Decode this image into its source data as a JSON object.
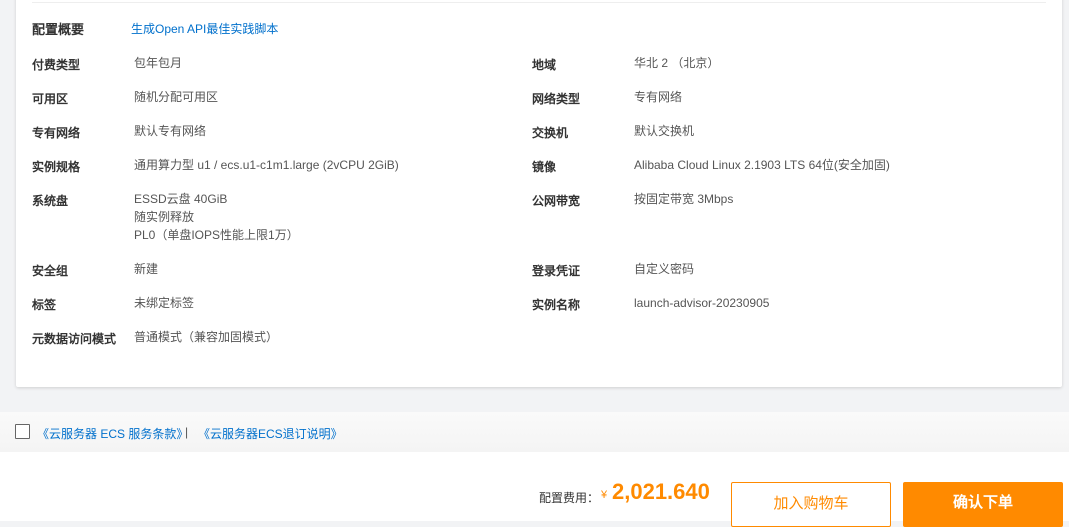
{
  "summary": {
    "title": "配置概要",
    "api_link": "生成Open API最佳实践脚本"
  },
  "left": [
    {
      "label": "付费类型",
      "value": [
        "包年包月"
      ]
    },
    {
      "label": "可用区",
      "value": [
        "随机分配可用区"
      ]
    },
    {
      "label": "专有网络",
      "value": [
        "默认专有网络"
      ]
    },
    {
      "label": "实例规格",
      "value": [
        "通用算力型 u1 / ecs.u1-c1m1.large (2vCPU 2GiB)"
      ]
    },
    {
      "label": "系统盘",
      "value": [
        "ESSD云盘 40GiB",
        "随实例释放",
        "PL0（单盘IOPS性能上限1万）"
      ]
    },
    {
      "label": "安全组",
      "value": [
        "新建"
      ]
    },
    {
      "label": "标签",
      "value": [
        "未绑定标签"
      ]
    },
    {
      "label": "元数据访问模式",
      "value": [
        "普通模式（兼容加固模式）"
      ]
    }
  ],
  "right": [
    {
      "label": "地域",
      "value": [
        "华北 2 （北京）"
      ]
    },
    {
      "label": "网络类型",
      "value": [
        "专有网络"
      ]
    },
    {
      "label": "交换机",
      "value": [
        "默认交换机"
      ]
    },
    {
      "label": "镜像",
      "value": [
        "Alibaba Cloud Linux 2.1903 LTS 64位(安全加固)"
      ]
    },
    {
      "label": "公网带宽",
      "value": [
        "按固定带宽 3Mbps"
      ]
    },
    {
      "label": "登录凭证",
      "value": [
        "自定义密码"
      ]
    },
    {
      "label": "实例名称",
      "value": [
        "launch-advisor-20230905"
      ]
    }
  ],
  "agreement": {
    "link1": "《云服务器 ECS 服务条款》",
    "separator": "|",
    "link2": "《云服务器ECS退订说明》"
  },
  "footer": {
    "fee_label": "配置费用：",
    "currency": "¥",
    "price": "2,021.640",
    "cart_button": "加入购物车",
    "buy_button": "确认下单"
  },
  "colors": {
    "accent": "#ff8a00",
    "link": "#0070cc"
  }
}
